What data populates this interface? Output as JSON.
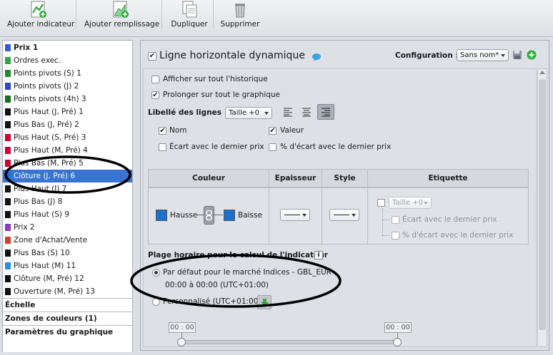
{
  "toolbar": {
    "add_indicator": "Ajouter indicateur",
    "add_fill": "Ajouter remplissage",
    "duplicate": "Dupliquer",
    "delete": "Supprimer"
  },
  "left_panel": {
    "items": [
      {
        "label": "Prix 1",
        "color": "#3b5cc6"
      },
      {
        "label": "Ordres exec.",
        "color": "#2aa84a"
      },
      {
        "label": "Points pivots (S) 1",
        "color": "#1f8a2e"
      },
      {
        "label": "Points pivots (J) 2",
        "color": "#3048c8"
      },
      {
        "label": "Points pivots (4h) 3",
        "color": "#1a6e1a"
      },
      {
        "label": "Plus Haut (J, Pré) 1",
        "color": "#111111"
      },
      {
        "label": "Plus Bas (J, Pré) 2",
        "color": "#111111"
      },
      {
        "label": "Plus Haut (S, Pré) 3",
        "color": "#cc0033"
      },
      {
        "label": "Plus Haut (M, Pré) 4",
        "color": "#cc0033"
      },
      {
        "label": "Plus Bas (M, Pré) 5",
        "color": "#cc0033"
      },
      {
        "label": "Clôture (J, Pré) 6",
        "color": "#1b6fcf"
      },
      {
        "label": "Plus Haut (J) 7",
        "color": "#111111"
      },
      {
        "label": "Plus Bas (J) 8",
        "color": "#111111"
      },
      {
        "label": "Plus Haut (S) 9",
        "color": "#111111"
      },
      {
        "label": "Prix 2",
        "color": "#8a3bc6"
      },
      {
        "label": "Zone d'Achat/Vente",
        "color": "#d0402a"
      },
      {
        "label": "Plus Bas (S) 10",
        "color": "#111111"
      },
      {
        "label": "Plus Haut (M) 11",
        "color": "#2a8fe0"
      },
      {
        "label": "Clôture (M, Pré) 12",
        "color": "#111111"
      },
      {
        "label": "Ouverture (M, Pré) 13",
        "color": "#111111"
      }
    ],
    "sections": {
      "scale": "Échelle",
      "color_zones": "Zones de couleurs (1)",
      "chart_params": "Paramètres du graphique"
    }
  },
  "panel": {
    "title": "Ligne horizontale dynamique",
    "config_label": "Configuration :",
    "config_value": "Sans nom*",
    "show_history": "Afficher sur tout l'historique",
    "extend_chart": "Prolonger sur tout le graphique",
    "lines_label": "Libellé des lignes",
    "size_value": "Taille +0",
    "name_label": "Nom",
    "value_label": "Valeur",
    "gap_last_price": "Écart avec le dernier prix",
    "pct_gap_last_price": "% d'écart avec le dernier prix",
    "table": {
      "col_color": "Couleur",
      "col_thickness": "Epaisseur",
      "col_style": "Style",
      "col_label": "Etiquette",
      "rise": "Hausse",
      "fall": "Baisse",
      "label_size": "Taille +0",
      "label_gap": "Écart avec le dernier prix",
      "label_pct_gap": "% d'écart avec le dernier prix"
    },
    "hours_title": "Plage horaire pour le calcul de l'indicateur",
    "default_market": "Par défaut pour le marché Indices - GBL_EUR",
    "default_hours": "00:00 à 00:00 (UTC+01:00)",
    "custom_label": "Personnalisé (UTC+01:00)",
    "slider_start": "00 : 00",
    "slider_end": "00 : 00"
  }
}
